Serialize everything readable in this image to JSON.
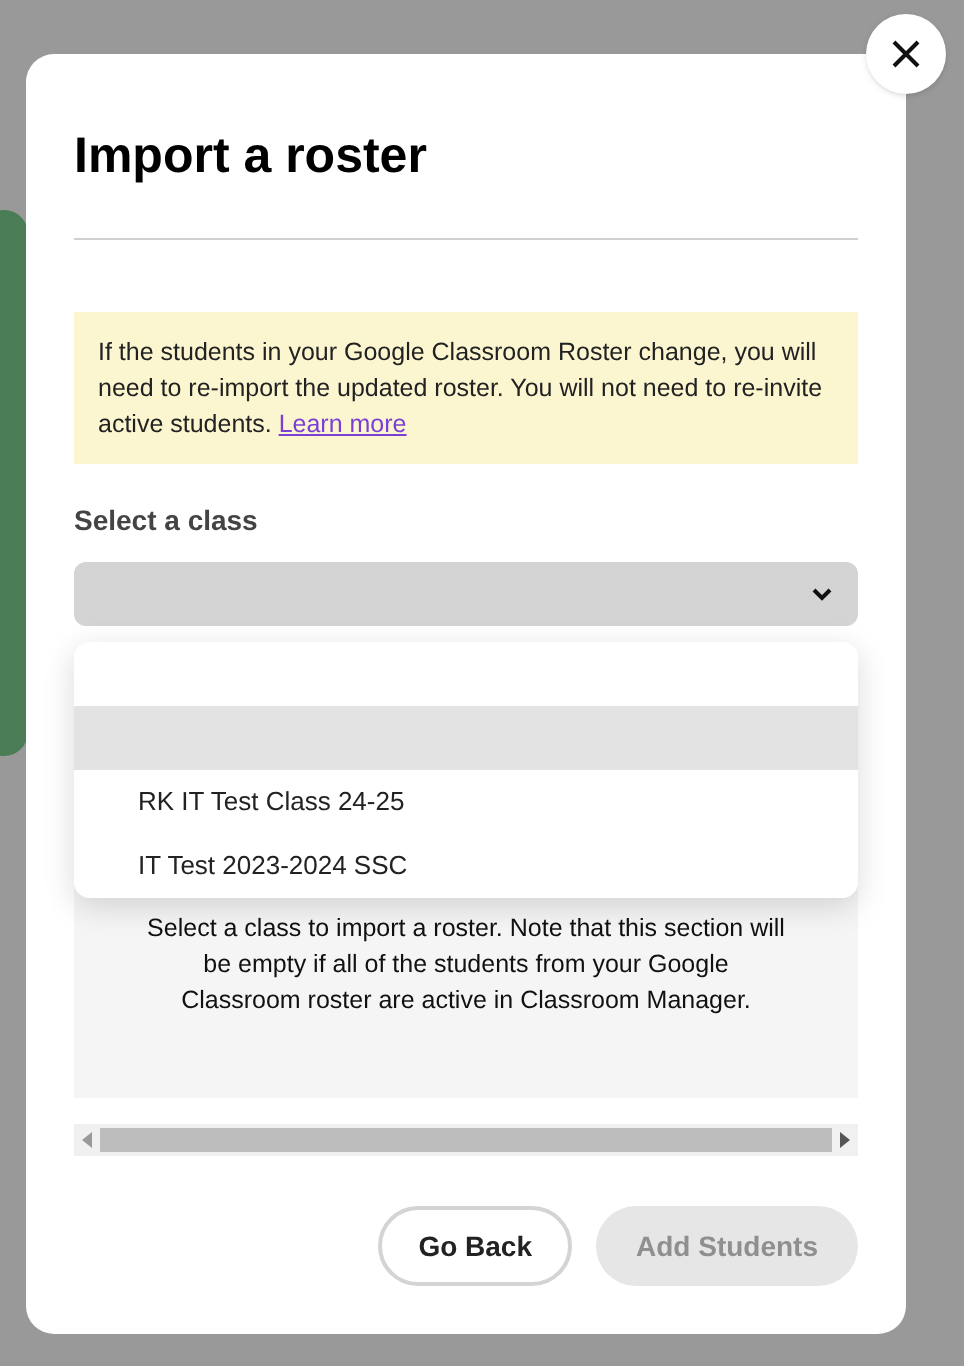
{
  "dialog": {
    "title": "Import a roster",
    "notice": {
      "text": "If the students in your Google Classroom Roster change, you will need to re-import the updated roster. You will not need to re-invite active students.",
      "link": "Learn more"
    },
    "field_label": "Select a class",
    "dropdown": {
      "expanded": true,
      "options": [
        {
          "kind": "blank",
          "highlighted": false
        },
        {
          "kind": "blank",
          "highlighted": true
        },
        {
          "kind": "class",
          "label": "RK IT Test Class 24-25",
          "highlighted": false
        },
        {
          "kind": "class",
          "label": "IT Test 2023-2024 SSC",
          "highlighted": false
        }
      ]
    },
    "empty_message": "Select a class to import a roster. Note that this section will be empty if all of the students from your Google Classroom roster are active in Classroom Manager.",
    "buttons": [
      {
        "label": "Go Back",
        "disabled": false
      },
      {
        "label": "Add Students",
        "disabled": true
      }
    ]
  }
}
